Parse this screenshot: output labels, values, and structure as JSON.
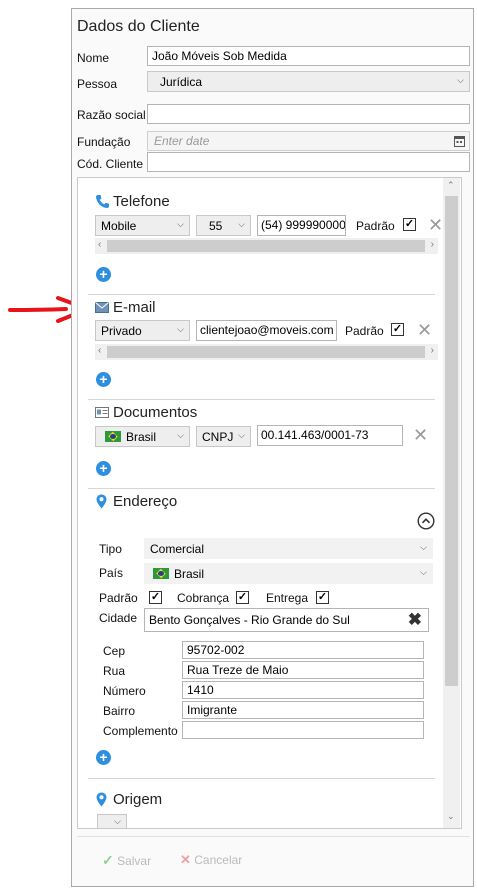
{
  "window": {
    "title": "Dados do Cliente"
  },
  "form": {
    "nome_label": "Nome",
    "nome_value": "João Móveis Sob Medida",
    "pessoa_label": "Pessoa",
    "pessoa_value": "Jurídica",
    "razao_label": "Razão social",
    "razao_value": "",
    "fundacao_label": "Fundação",
    "fundacao_placeholder": "Enter date",
    "cod_label": "Cód. Cliente",
    "cod_value": ""
  },
  "telefone": {
    "title": "Telefone",
    "type": "Mobile",
    "ddi": "55",
    "number": "(54) 999990000",
    "padrao_label": "Padrão",
    "padrao_checked": true
  },
  "email": {
    "title": "E-mail",
    "type": "Privado",
    "address": "clientejoao@moveis.com",
    "padrao_label": "Padrão",
    "padrao_checked": true
  },
  "documentos": {
    "title": "Documentos",
    "country": "Brasil",
    "doc_type": "CNPJ",
    "number": "00.141.463/0001-73"
  },
  "endereco": {
    "title": "Endereço",
    "tipo_label": "Tipo",
    "tipo_value": "Comercial",
    "pais_label": "País",
    "pais_value": "Brasil",
    "padrao_label": "Padrão",
    "cobranca_label": "Cobrança",
    "entrega_label": "Entrega",
    "padrao_checked": true,
    "cobranca_checked": true,
    "entrega_checked": true,
    "cidade_label": "Cidade",
    "cidade_value": "Bento Gonçalves - Rio Grande do Sul",
    "cep_label": "Cep",
    "cep_value": "95702-002",
    "rua_label": "Rua",
    "rua_value": "Rua Treze de Maio",
    "numero_label": "Número",
    "numero_value": "1410",
    "bairro_label": "Bairro",
    "bairro_value": "Imigrante",
    "complemento_label": "Complemento",
    "complemento_value": ""
  },
  "origem": {
    "title": "Origem"
  },
  "footer": {
    "save_label": "Salvar",
    "cancel_label": "Cancelar"
  },
  "icons": {
    "phone": "phone-icon",
    "mail": "mail-icon",
    "id_card": "id-card-icon",
    "pin": "map-pin-icon",
    "add": "plus-circle-icon",
    "remove": "close-icon",
    "calendar": "calendar-icon",
    "collapse": "chevron-up-circle-icon",
    "clear": "clear-x-icon",
    "check": "checkmark-icon",
    "annotation_arrow": "red-arrow-icon"
  },
  "colors": {
    "accent": "#2f8fdf",
    "annotation": "#e8141a",
    "checkmark_disabled": "#8fd18f",
    "cancel_disabled": "#f0a0a0"
  }
}
